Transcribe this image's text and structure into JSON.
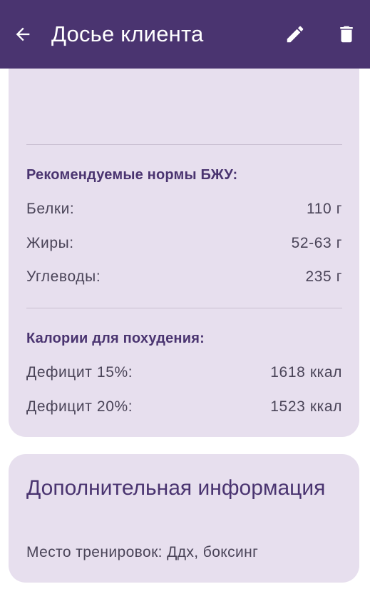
{
  "appbar": {
    "title": "Досье клиента",
    "back_icon": "arrow-back-icon",
    "edit_icon": "pencil-icon",
    "delete_icon": "trash-icon"
  },
  "colors": {
    "appbar": "#4a3470",
    "card_bg": "#e7dfee",
    "accent_text": "#4a3470",
    "body_text": "#4a4458"
  },
  "macros": {
    "title": "Рекомендуемые нормы БЖУ:",
    "rows": [
      {
        "label": "Белки:",
        "value": "110 г"
      },
      {
        "label": "Жиры:",
        "value": "52-63 г"
      },
      {
        "label": "Углеводы:",
        "value": "235 г"
      }
    ]
  },
  "calories": {
    "title": "Калории для похудения:",
    "rows": [
      {
        "label": "Дефицит 15%:",
        "value": "1618 ккал"
      },
      {
        "label": "Дефицит 20%:",
        "value": "1523 ккал"
      }
    ]
  },
  "extra": {
    "heading": "Дополнительная информация",
    "info": "Место тренировок: Ддх, боксинг"
  }
}
